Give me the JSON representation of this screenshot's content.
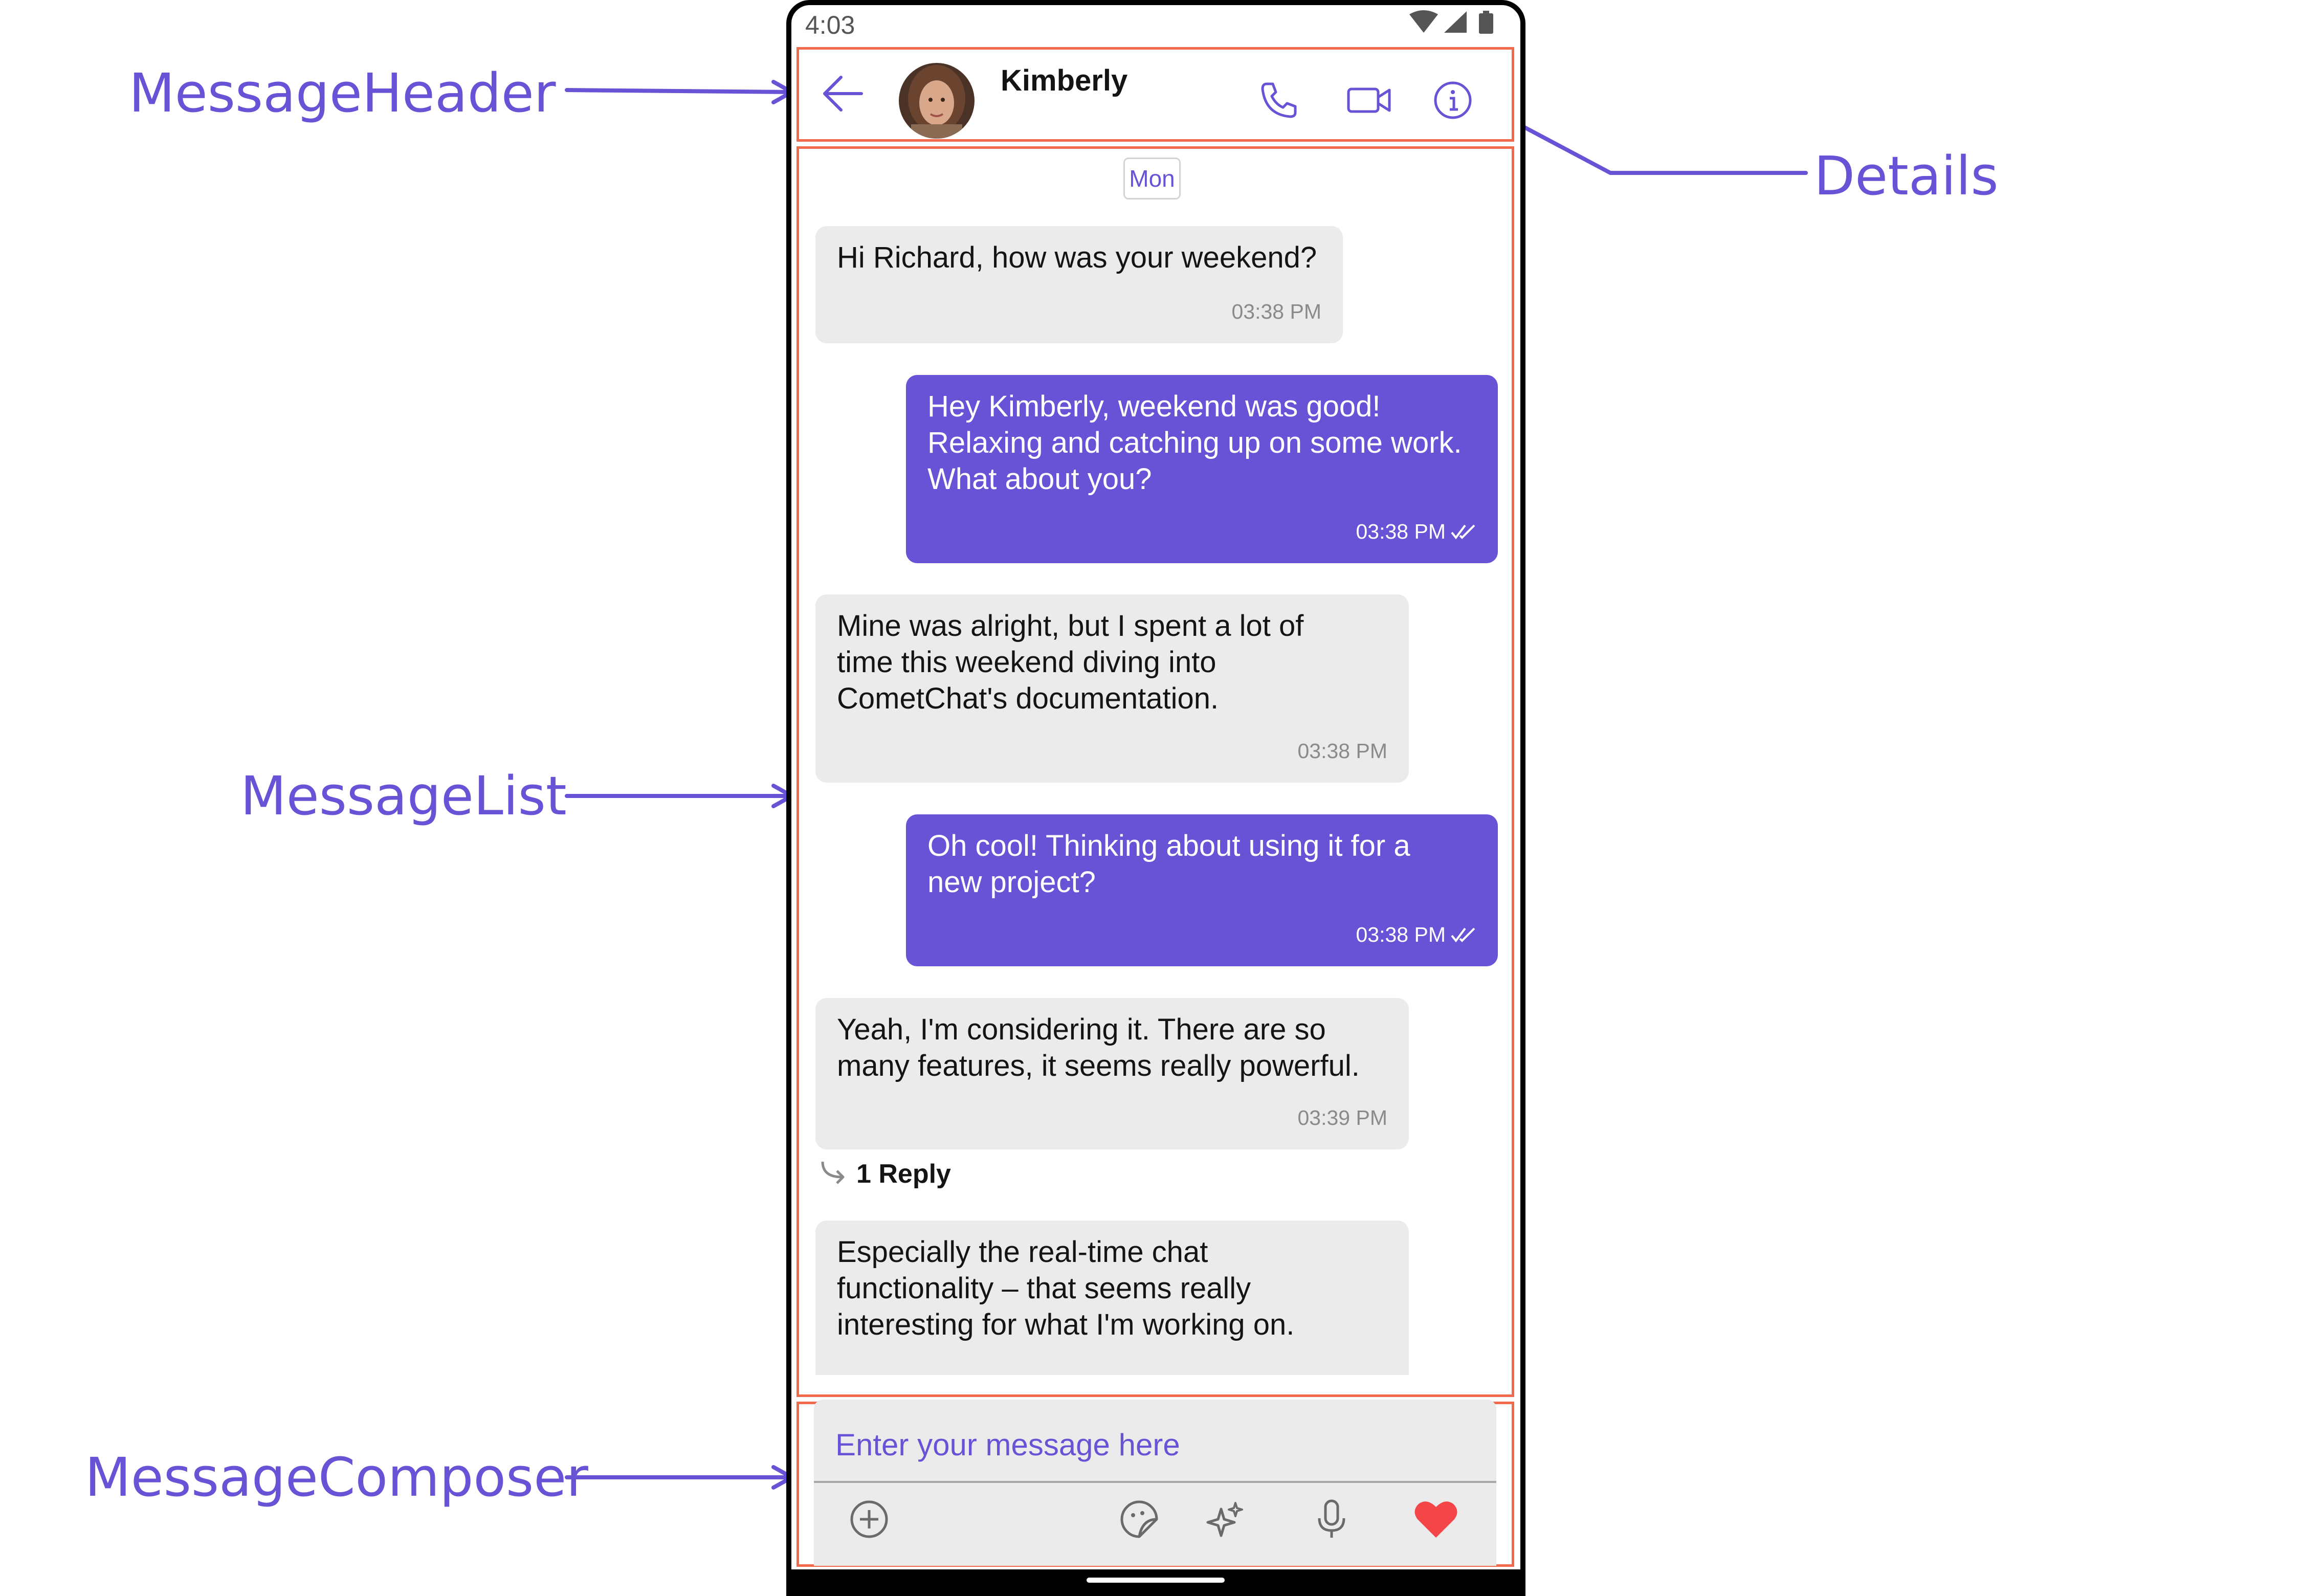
{
  "annotations": {
    "header": "MessageHeader",
    "details": "Details",
    "list": "MessageList",
    "composer": "MessageComposer"
  },
  "status_bar": {
    "time": "4:03",
    "icons": [
      "wifi-icon",
      "signal-icon",
      "battery-icon"
    ]
  },
  "header": {
    "contact_name": "Kimberly",
    "icons": [
      "back-arrow-icon",
      "phone-call-icon",
      "video-call-icon",
      "info-icon"
    ]
  },
  "messages": {
    "date_separator": "Mon",
    "m1": {
      "text": "Hi Richard, how was your weekend?",
      "time": "03:38 PM"
    },
    "m2": {
      "text": "Hey Kimberly, weekend was good!\nRelaxing and catching up on some work.\nWhat about you?",
      "time": "03:38 PM"
    },
    "m3": {
      "text": "Mine was alright, but I spent a lot of\ntime this weekend diving into\nCometChat's documentation.",
      "time": "03:38 PM"
    },
    "m4": {
      "text": "Oh cool! Thinking about using it for a\nnew project?",
      "time": "03:38 PM"
    },
    "m5": {
      "text": "Yeah, I'm considering it.  There are so\nmany features, it seems really powerful.",
      "time": "03:39 PM",
      "reply_label": "1 Reply"
    },
    "m6": {
      "text": "Especially the real-time chat\nfunctionality – that seems really\ninteresting for what I'm working on."
    }
  },
  "composer": {
    "placeholder": "Enter your message here",
    "icons": [
      "add-attachment-icon",
      "sticker-icon",
      "ai-sparkle-icon",
      "microphone-icon",
      "heart-icon"
    ]
  },
  "colors": {
    "accent": "#6852d6",
    "outline": "#f06a4b",
    "bubble_incoming": "#ebebeb",
    "heart": "#f44649"
  }
}
